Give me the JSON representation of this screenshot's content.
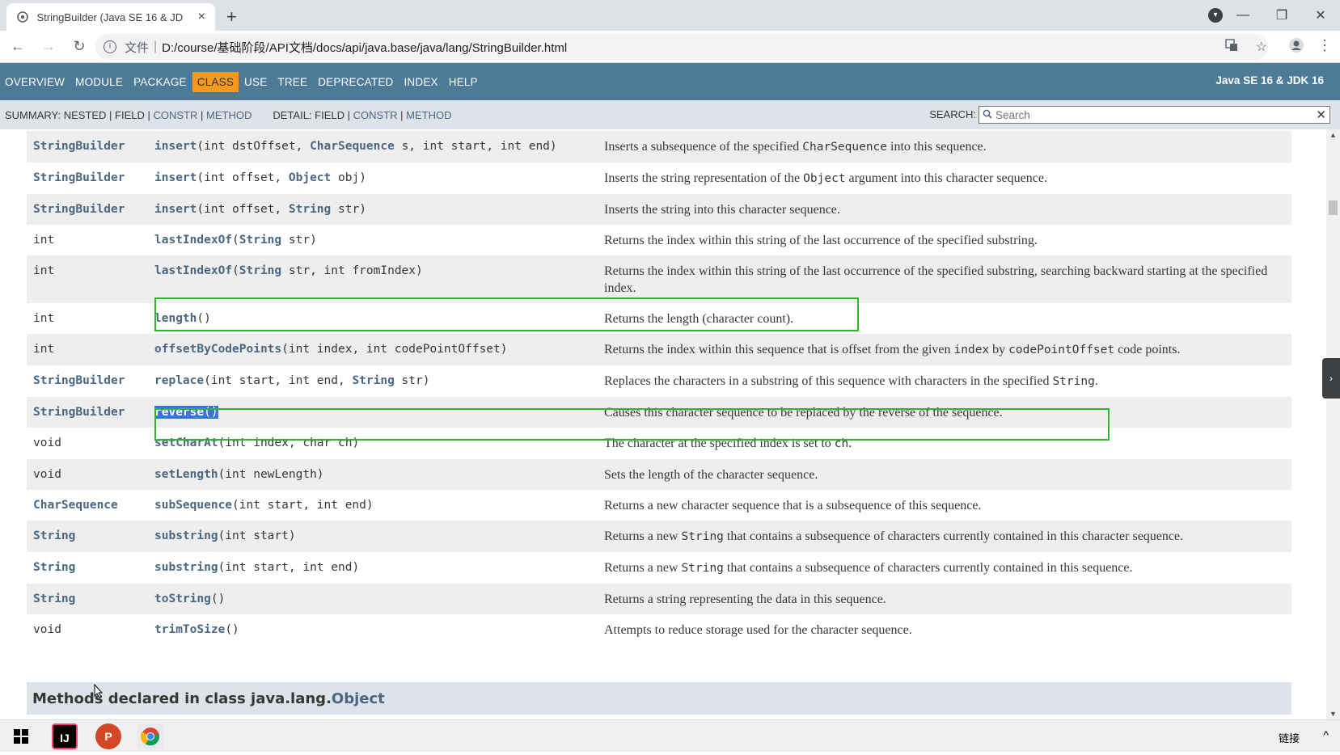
{
  "browser": {
    "tab_title": "StringBuilder (Java SE 16 & JD",
    "tab_close": "×",
    "new_tab": "+",
    "address_scheme": "文件",
    "address_url": "D:/course/基础阶段/API文档/docs/api/java.base/java/lang/StringBuilder.html"
  },
  "javadoc_nav": {
    "items": [
      "OVERVIEW",
      "MODULE",
      "PACKAGE",
      "CLASS",
      "USE",
      "TREE",
      "DEPRECATED",
      "INDEX",
      "HELP"
    ],
    "active": "CLASS",
    "brand": "Java SE 16 & JDK 16"
  },
  "subnav": {
    "summary_label": "SUMMARY: NESTED | FIELD |",
    "summary_constr": "CONSTR",
    "summary_sep": "|",
    "summary_method": "METHOD",
    "detail_label": "DETAIL: FIELD |",
    "detail_constr": "CONSTR",
    "detail_sep": "|",
    "detail_method": "METHOD",
    "search_label": "SEARCH:",
    "search_placeholder": "Search"
  },
  "methods": [
    {
      "type": "StringBuilder",
      "type_link": true,
      "name": "insert",
      "params": "(int dstOffset, CharSequence s, int start, int end)",
      "desc": "Inserts a subsequence of the specified CharSequence into this sequence."
    },
    {
      "type": "StringBuilder",
      "type_link": true,
      "name": "insert",
      "params": "(int offset, Object obj)",
      "desc": "Inserts the string representation of the Object argument into this character sequence."
    },
    {
      "type": "StringBuilder",
      "type_link": true,
      "name": "insert",
      "params": "(int offset, String str)",
      "desc": "Inserts the string into this character sequence."
    },
    {
      "type": "int",
      "type_link": false,
      "name": "lastIndexOf",
      "params": "(String str)",
      "desc": "Returns the index within this string of the last occurrence of the specified substring."
    },
    {
      "type": "int",
      "type_link": false,
      "name": "lastIndexOf",
      "params": "(String str, int fromIndex)",
      "desc": "Returns the index within this string of the last occurrence of the specified substring, searching backward starting at the specified index."
    },
    {
      "type": "int",
      "type_link": false,
      "name": "length",
      "params": "()",
      "desc": "Returns the length (character count)."
    },
    {
      "type": "int",
      "type_link": false,
      "name": "offsetByCodePoints",
      "params": "(int index, int codePointOffset)",
      "desc": "Returns the index within this sequence that is offset from the given index by codePointOffset code points."
    },
    {
      "type": "StringBuilder",
      "type_link": true,
      "name": "replace",
      "params": "(int start, int end, String str)",
      "desc": "Replaces the characters in a substring of this sequence with characters in the specified String."
    },
    {
      "type": "StringBuilder",
      "type_link": true,
      "name": "reverse",
      "params": "()",
      "desc": "Causes this character sequence to be replaced by the reverse of the sequence."
    },
    {
      "type": "void",
      "type_link": false,
      "name": "setCharAt",
      "params": "(int index, char ch)",
      "desc": "The character at the specified index is set to ch."
    },
    {
      "type": "void",
      "type_link": false,
      "name": "setLength",
      "params": "(int newLength)",
      "desc": "Sets the length of the character sequence."
    },
    {
      "type": "CharSequence",
      "type_link": true,
      "name": "subSequence",
      "params": "(int start, int end)",
      "desc": "Returns a new character sequence that is a subsequence of this sequence."
    },
    {
      "type": "String",
      "type_link": true,
      "name": "substring",
      "params": "(int start)",
      "desc": "Returns a new String that contains a subsequence of characters currently contained in this character sequence."
    },
    {
      "type": "String",
      "type_link": true,
      "name": "substring",
      "params": "(int start, int end)",
      "desc": "Returns a new String that contains a subsequence of characters currently contained in this sequence."
    },
    {
      "type": "String",
      "type_link": true,
      "name": "toString",
      "params": "()",
      "desc": "Returns a string representing the data in this sequence."
    },
    {
      "type": "void",
      "type_link": false,
      "name": "trimToSize",
      "params": "()",
      "desc": "Attempts to reduce storage used for the character sequence."
    }
  ],
  "inherited": {
    "prefix": "Methods declared in class java.lang.",
    "link": "Object"
  },
  "taskbar": {
    "label": "链接",
    "chevron": "^"
  },
  "colors": {
    "nav_bg": "#4d7a97",
    "nav_active": "#f8981d",
    "link": "#4a6782",
    "highlight_box": "#2db52d",
    "selection": "#3875d7"
  }
}
